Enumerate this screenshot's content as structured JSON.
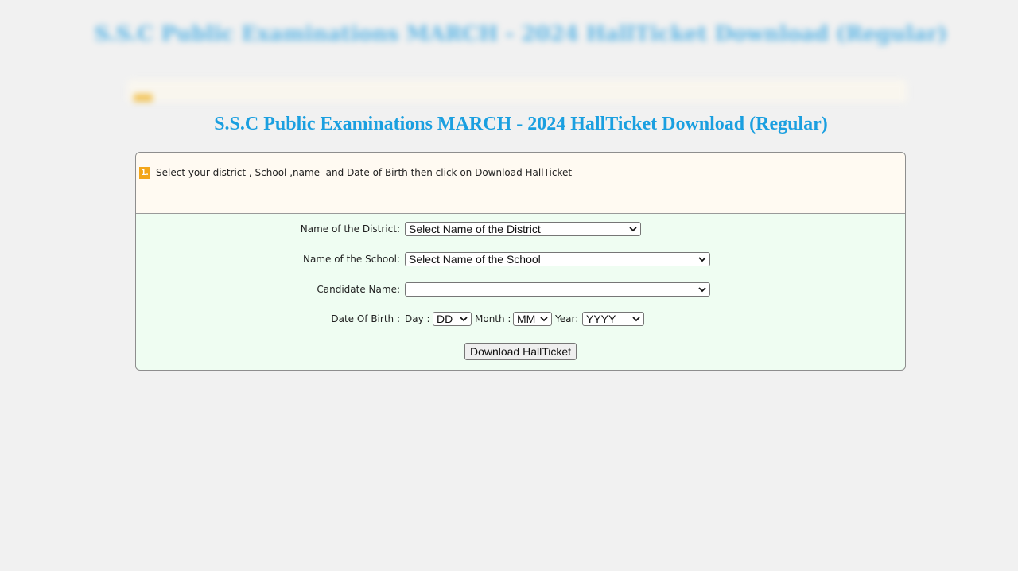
{
  "page": {
    "title": "S.S.C Public Examinations MARCH - 2024 HallTicket Download (Regular)"
  },
  "instruction": {
    "step": "1.",
    "text": "Select your district , School ,name  and Date of Birth then click on Download HallTicket"
  },
  "form": {
    "district": {
      "label": "Name of the District:",
      "selected": "Select Name of the District"
    },
    "school": {
      "label": "Name of the School:",
      "selected": "Select Name of the School"
    },
    "candidate": {
      "label": "Candidate Name:",
      "selected": ""
    },
    "dob": {
      "label": "Date Of Birth :",
      "day_label": "Day :",
      "day_selected": "DD",
      "month_label": "Month :",
      "month_selected": "MM",
      "year_label": "Year:",
      "year_selected": "YYYY"
    },
    "submit_label": "Download HallTicket"
  },
  "icons": {
    "dropdown": "chevron-down-icon"
  },
  "colors": {
    "title": "#1a9fe0",
    "badge": "#f3a61a",
    "instruction_bg": "#fffaf2",
    "form_bg": "#effdf2"
  }
}
